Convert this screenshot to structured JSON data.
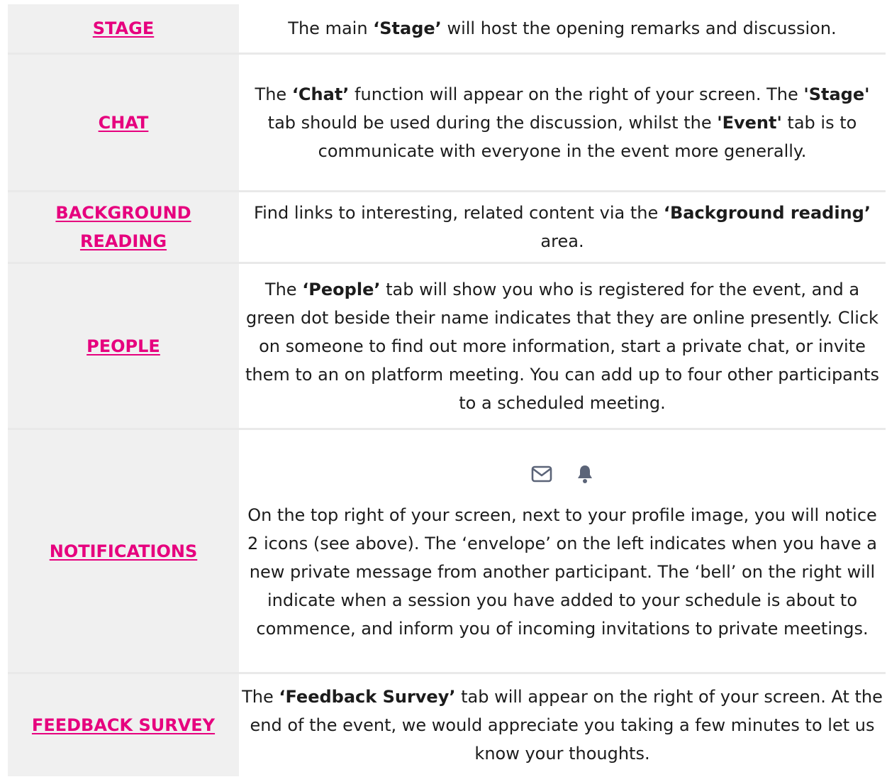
{
  "rows": [
    {
      "label": "STAGE",
      "parts": [
        "The main ",
        "‘Stage’",
        " will host the opening remarks and discussion."
      ]
    },
    {
      "label": "CHAT",
      "parts": [
        "The ",
        "‘Chat’",
        " function will appear on the right of your screen. The ",
        "'Stage'",
        " tab should be used during the discussion, whilst the ",
        "'Event'",
        " tab is to communicate with everyone in the event more generally."
      ]
    },
    {
      "label": "BACKGROUND READING",
      "parts": [
        "Find links to interesting, related content via the ",
        "‘Background reading’",
        " area."
      ]
    },
    {
      "label": "PEOPLE",
      "parts": [
        "The ",
        "‘People’",
        " tab will show you who is registered for the event, and a green dot beside their name indicates that they are online presently. Click on someone to find out more information, start a private chat, or invite them to an on platform meeting. You can add up to four other participants to a scheduled meeting."
      ]
    },
    {
      "label": "NOTIFICATIONS",
      "icons": [
        "envelope-icon",
        "bell-icon"
      ],
      "text": "On the top right of your screen, next to your profile image, you will notice 2 icons (see above). The ‘envelope’ on the left indicates when you have a new private message from another participant. The ‘bell’ on the right will indicate when a session you have added to your schedule is about to commence, and inform you of incoming invitations to private meetings."
    },
    {
      "label": "FEEDBACK SURVEY",
      "parts": [
        "The ",
        "‘Feedback Survey’",
        " tab will appear on the right of your screen. At the end of the event, we would appreciate you taking a few minutes to let us know your thoughts."
      ]
    }
  ],
  "colors": {
    "link": "#e6007e",
    "label_bg": "#f0f0f0",
    "divider": "#e9e9e9",
    "icon": "#5b6478"
  }
}
